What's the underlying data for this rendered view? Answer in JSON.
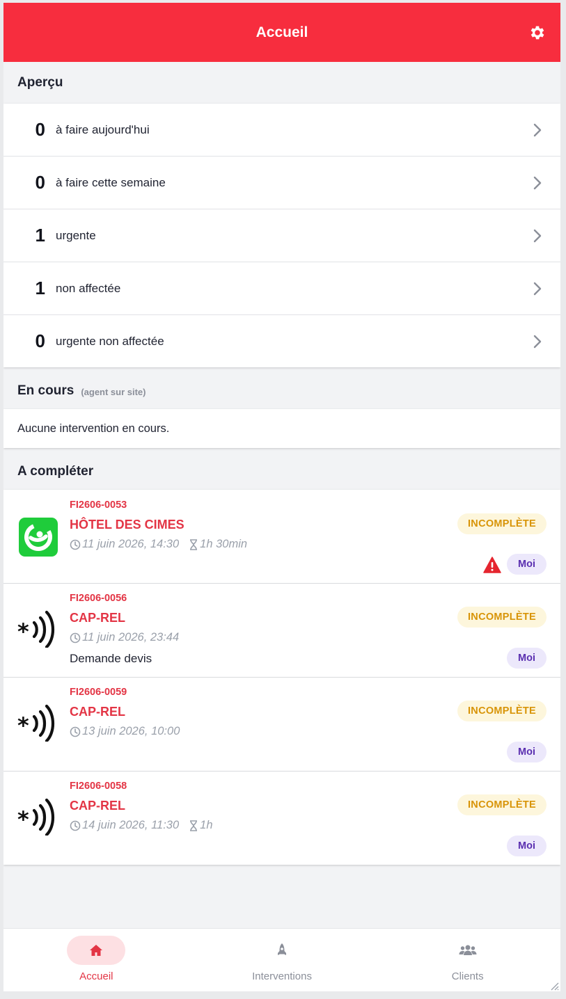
{
  "header": {
    "title": "Accueil",
    "settings_icon": "gear-icon"
  },
  "overview": {
    "title": "Aperçu",
    "rows": [
      {
        "count": "0",
        "label": "à faire aujourd'hui"
      },
      {
        "count": "0",
        "label": "à faire cette semaine"
      },
      {
        "count": "1",
        "label": "urgente"
      },
      {
        "count": "1",
        "label": "non affectée"
      },
      {
        "count": "0",
        "label": "urgente non affectée"
      }
    ]
  },
  "ongoing": {
    "title": "En cours",
    "subtitle": "(agent sur site)",
    "empty_text": "Aucune intervention en cours."
  },
  "to_complete": {
    "title": "A compléter",
    "items": [
      {
        "ref": "FI2606-0053",
        "client": "HÔTEL DES CIMES",
        "date": "11 juin 2026, 14:30",
        "duration": "1h 30min",
        "note": "",
        "status": "INCOMPLÈTE",
        "assignee": "Moi",
        "logo": "green-app-logo",
        "urgent": true
      },
      {
        "ref": "FI2606-0056",
        "client": "CAP-REL",
        "date": "11 juin 2026, 23:44",
        "duration": "",
        "note": "Demande devis",
        "status": "INCOMPLÈTE",
        "assignee": "Moi",
        "logo": "cap-rel-logo",
        "urgent": false
      },
      {
        "ref": "FI2606-0059",
        "client": "CAP-REL",
        "date": "13 juin 2026, 10:00",
        "duration": "",
        "note": "",
        "status": "INCOMPLÈTE",
        "assignee": "Moi",
        "logo": "cap-rel-logo",
        "urgent": false
      },
      {
        "ref": "FI2606-0058",
        "client": "CAP-REL",
        "date": "14 juin 2026, 11:30",
        "duration": "1h",
        "note": "",
        "status": "INCOMPLÈTE",
        "assignee": "Moi",
        "logo": "cap-rel-logo",
        "urgent": false
      }
    ]
  },
  "bottom_nav": [
    {
      "label": "Accueil",
      "icon": "home-icon",
      "active": true
    },
    {
      "label": "Interventions",
      "icon": "rocket-icon",
      "active": false
    },
    {
      "label": "Clients",
      "icon": "users-icon",
      "active": false
    }
  ],
  "colors": {
    "brand": "#f72d3e",
    "accent_text": "#e33545",
    "status": "#d89407",
    "assignee": "#5a2fb0"
  }
}
